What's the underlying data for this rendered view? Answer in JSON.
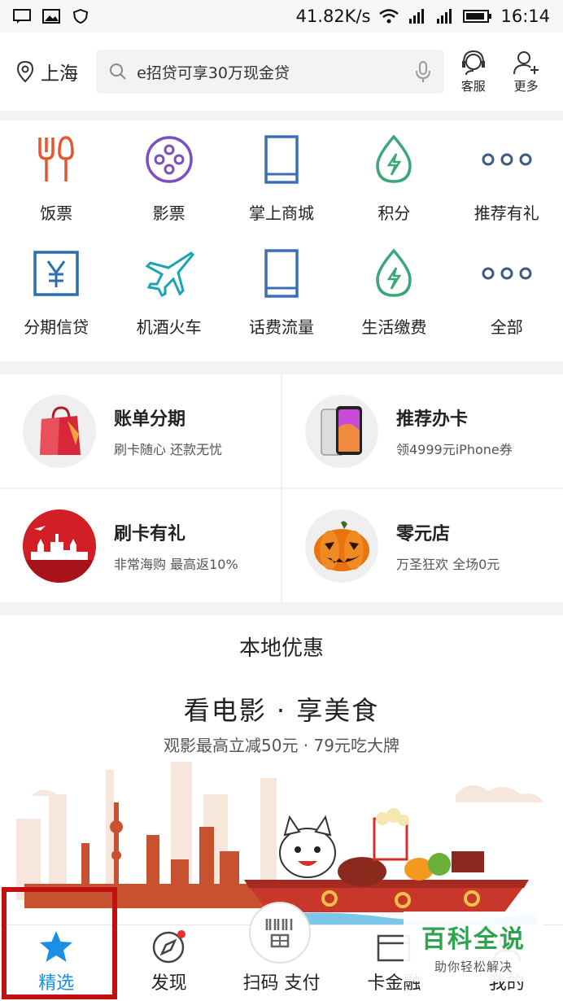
{
  "status": {
    "net_speed": "41.82K/s",
    "time": "16:14"
  },
  "header": {
    "location": "上海",
    "search_placeholder": "e招贷可享30万现金贷",
    "customer_service": "客服",
    "more": "更多"
  },
  "grid": [
    {
      "label": "饭票",
      "icon": "fork-knife-icon"
    },
    {
      "label": "影票",
      "icon": "film-reel-icon"
    },
    {
      "label": "掌上商城",
      "icon": "tablet-icon"
    },
    {
      "label": "积分",
      "icon": "drop-bolt-icon"
    },
    {
      "label": "推荐有礼",
      "icon": "dots-icon"
    },
    {
      "label": "分期信贷",
      "icon": "yuan-icon"
    },
    {
      "label": "机酒火车",
      "icon": "plane-icon"
    },
    {
      "label": "话费流量",
      "icon": "tablet-icon"
    },
    {
      "label": "生活缴费",
      "icon": "drop-bolt-icon"
    },
    {
      "label": "全部",
      "icon": "dots-icon"
    }
  ],
  "promos": [
    {
      "title": "账单分期",
      "subtitle": "刷卡随心 还款无忧"
    },
    {
      "title": "推荐办卡",
      "subtitle": "领4999元iPhone券"
    },
    {
      "title": "刷卡有礼",
      "subtitle": "非常海购 最高返10%"
    },
    {
      "title": "零元店",
      "subtitle": "万圣狂欢 全场0元"
    }
  ],
  "local": {
    "title": "本地优惠",
    "banner_title": "看电影 · 享美食",
    "banner_subtitle": "观影最高立减50元 · 79元吃大牌"
  },
  "nav": {
    "featured": "精选",
    "discover": "发现",
    "scan_pay": "扫码 支付",
    "card_finance": "卡金融",
    "mine": "我的"
  },
  "watermark": {
    "title": "百科全说",
    "subtitle": "助你轻松解决"
  },
  "colors": {
    "accent": "#1a8fe3",
    "icon_blue": "#3d6fb5",
    "icon_red": "#e4572e",
    "icon_purple": "#7b4fc0",
    "icon_green": "#3aa776",
    "highlight_box": "#c0100f"
  }
}
